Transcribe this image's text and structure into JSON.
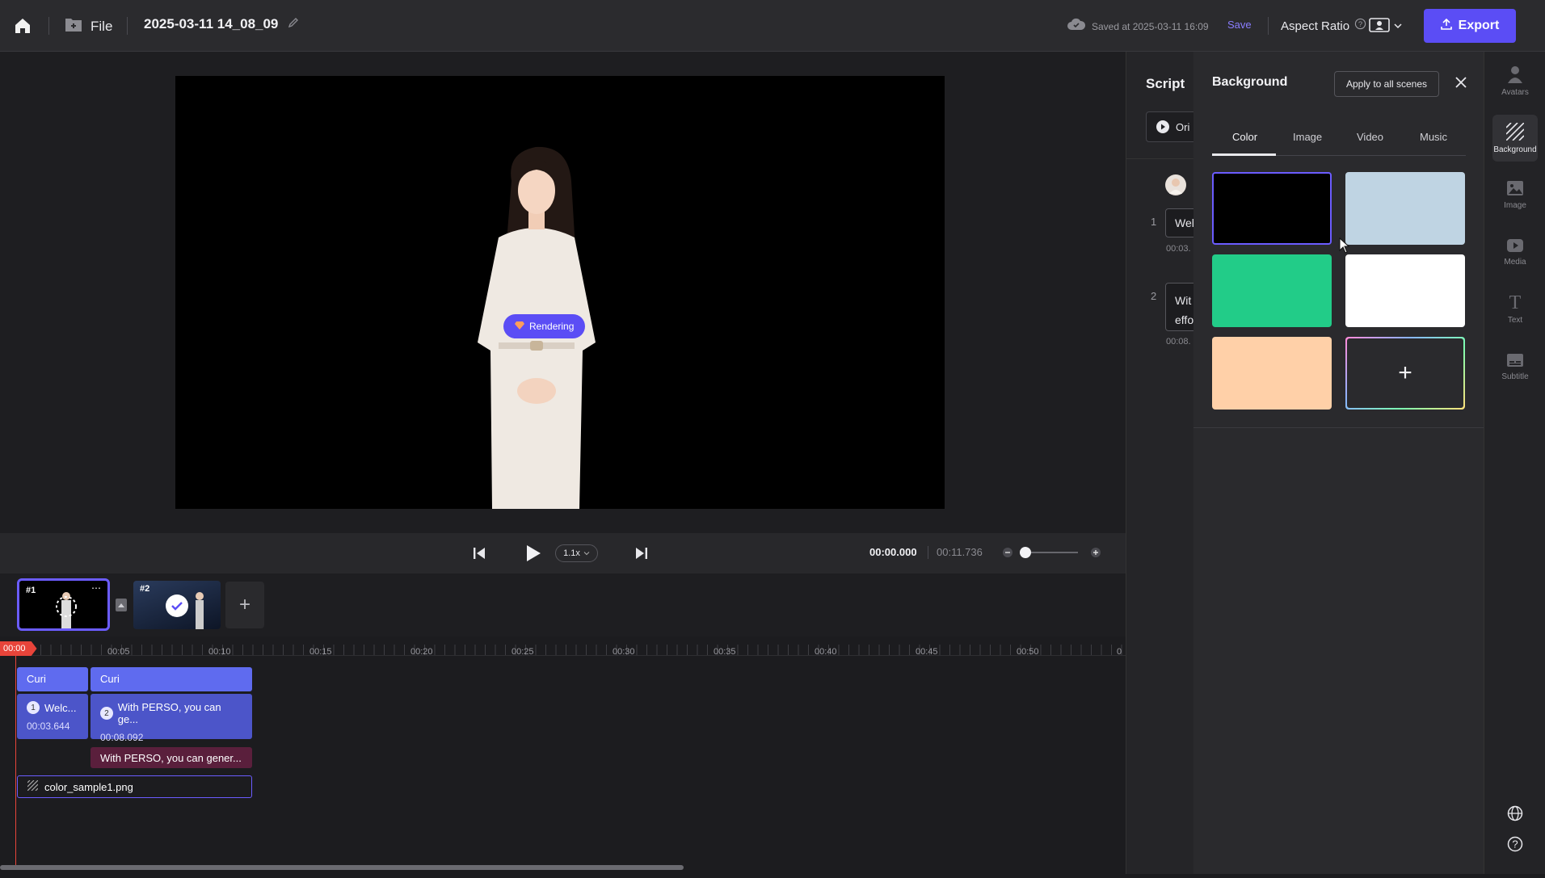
{
  "topbar": {
    "file_label": "File",
    "project_title": "2025-03-11 14_08_09",
    "saved_status": "Saved at 2025-03-11 16:09",
    "save_label": "Save",
    "aspect_ratio_label": "Aspect Ratio",
    "export_label": "Export"
  },
  "preview": {
    "rendering_label": "Rendering"
  },
  "player": {
    "speed": "1.1x",
    "current_time": "00:00.000",
    "total_time": "00:11.736"
  },
  "scenes": [
    {
      "label": "#1"
    },
    {
      "label": "#2"
    }
  ],
  "timeline": {
    "playhead": "00:00",
    "ticks": [
      "00:05",
      "00:10",
      "00:15",
      "00:20",
      "00:25",
      "00:30",
      "00:35",
      "00:40",
      "00:45",
      "00:50",
      "0"
    ],
    "avatar_clips": [
      "Curi",
      "Curi"
    ],
    "script_clips": [
      {
        "num": "1",
        "text": "Welc...",
        "duration": "00:03.644"
      },
      {
        "num": "2",
        "text": "With PERSO, you can ge...",
        "duration": "00:08.092"
      }
    ],
    "subtitle_clip": "With PERSO, you can gener...",
    "background_clip": "color_sample1.png"
  },
  "script_panel": {
    "title": "Script",
    "original_label": "Ori",
    "items": [
      {
        "num": "1",
        "text": "Wel",
        "time": "00:03."
      },
      {
        "num": "2",
        "text_line1": "Wit",
        "text_line2": "effo",
        "time": "00:08."
      }
    ]
  },
  "background_panel": {
    "title": "Background",
    "apply_label": "Apply to all scenes",
    "tabs": [
      "Color",
      "Image",
      "Video",
      "Music"
    ],
    "active_tab": "Color",
    "swatches": [
      "#000000",
      "#bfd4e3",
      "#22cc88",
      "#ffffff",
      "#ffd0a8"
    ],
    "selected_swatch": "#000000",
    "add_label": "+"
  },
  "rail": {
    "items": [
      "Avatars",
      "Background",
      "Image",
      "Media",
      "Text",
      "Subtitle"
    ],
    "active": "Background"
  },
  "colors": {
    "accent": "#5b4df5",
    "clip_blue": "#5f6bef",
    "playhead_red": "#e8443a"
  }
}
